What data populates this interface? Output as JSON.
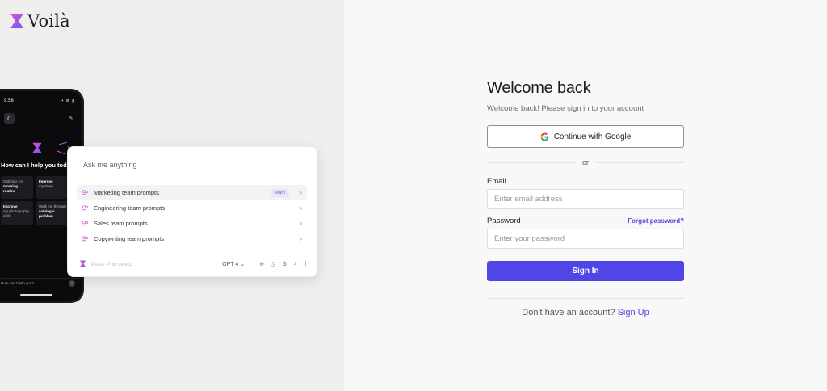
{
  "brand": {
    "name": "Voilà",
    "accent": "#4f46e5",
    "logo_gradient": [
      "#e64bd2",
      "#6a5cf5"
    ]
  },
  "phone": {
    "time": "9:58",
    "status_icons": "▪ ≋ ▮",
    "heading": "How can I help you today?",
    "cards": [
      {
        "line1": "Optimize my",
        "line2": "morning routine"
      },
      {
        "line1": "Improve",
        "line2": "my sleep"
      },
      {
        "line1": "Improve",
        "line2": "my photography",
        "line3": "skills"
      },
      {
        "line1": "Walk me through",
        "line2": "solving a problem"
      }
    ],
    "input_placeholder": "How can I help you?"
  },
  "prompt_panel": {
    "input_placeholder": "Ask me anything",
    "items": [
      {
        "label": "Marketing team prompts",
        "badge": "Team",
        "active": true
      },
      {
        "label": "Engineering team prompts"
      },
      {
        "label": "Sales team prompts"
      },
      {
        "label": "Copywriting team prompts"
      }
    ],
    "footer_hint": "Press ⏎ to select",
    "model": "GPT 4"
  },
  "signin": {
    "title": "Welcome back",
    "subtitle": "Welcome back! Please sign in to your account",
    "google_button": "Continue with Google",
    "or": "or",
    "email_label": "Email",
    "email_placeholder": "Enter email address",
    "password_label": "Password",
    "forgot_password": "Forgot password?",
    "password_placeholder": "Enter your password",
    "submit": "Sign In",
    "no_account": "Don't have an account?",
    "signup_link": "Sign Up"
  }
}
